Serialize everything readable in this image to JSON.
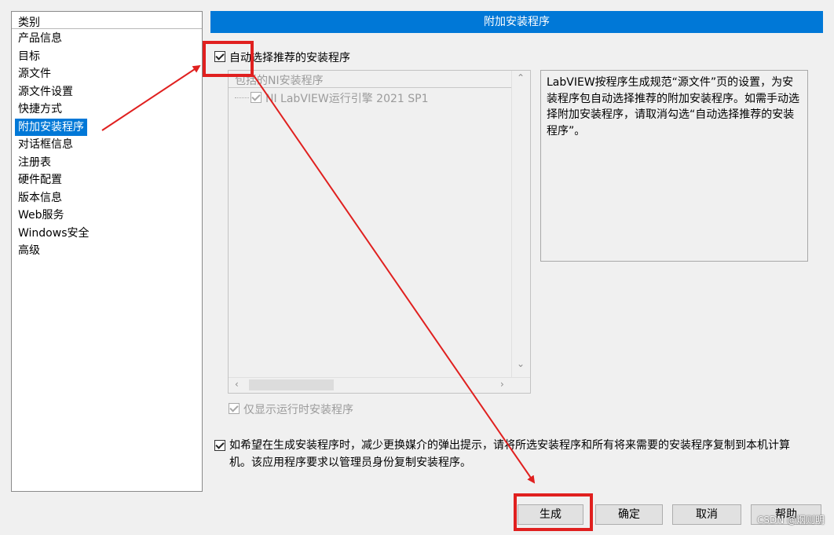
{
  "categories": {
    "header": "类别",
    "items": [
      {
        "label": "产品信息"
      },
      {
        "label": "目标"
      },
      {
        "label": "源文件"
      },
      {
        "label": "源文件设置"
      },
      {
        "label": "快捷方式"
      },
      {
        "label": "附加安装程序"
      },
      {
        "label": "对话框信息"
      },
      {
        "label": "注册表"
      },
      {
        "label": "硬件配置"
      },
      {
        "label": "版本信息"
      },
      {
        "label": "Web服务"
      },
      {
        "label": "Windows安全"
      },
      {
        "label": "高级"
      }
    ],
    "selected": "附加安装程序"
  },
  "pane": {
    "title": "附加安装程序",
    "auto_select_label": "自动选择推荐的安装程序",
    "tree_header": "包括的NI安装程序",
    "tree_items": [
      {
        "label": "NI LabVIEW运行引擎 2021 SP1"
      }
    ],
    "description": "LabVIEW按程序生成规范“源文件”页的设置，为安装程序包自动选择推荐的附加安装程序。如需手动选择附加安装程序，请取消勾选“自动选择推荐的安装程序”。",
    "runtime_only_label": "仅显示运行时安装程序",
    "copy_installers_label": "如希望在生成安装程序时，减少更换媒介的弹出提示，请将所选安装程序和所有将来需要的安装程序复制到本机计算机。该应用程序要求以管理员身份复制安装程序。"
  },
  "buttons": {
    "build": "生成",
    "ok": "确定",
    "cancel": "取消",
    "help": "帮助"
  },
  "watermark": "CSDN @烟则明",
  "colors": {
    "accent": "#0078d7",
    "highlight": "#e0201f"
  }
}
